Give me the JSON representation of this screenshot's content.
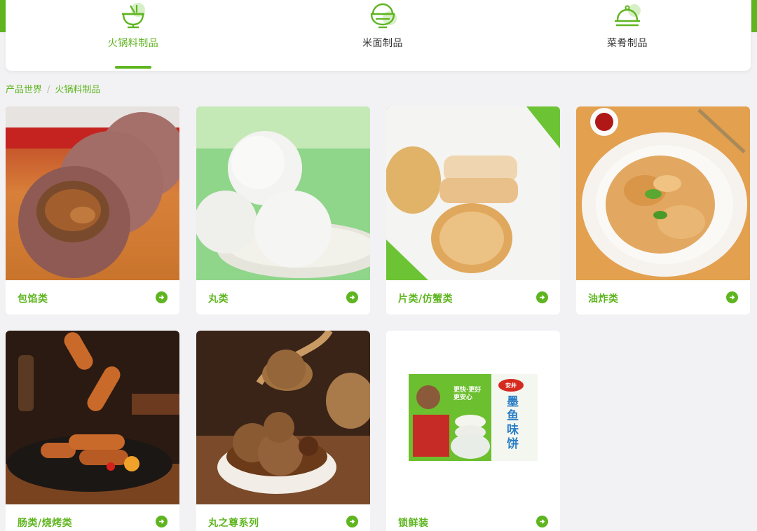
{
  "tabs": [
    {
      "label": "火锅料制品",
      "icon": "hotpot-bowl-icon",
      "active": true
    },
    {
      "label": "米面制品",
      "icon": "rice-bowl-icon",
      "active": false
    },
    {
      "label": "菜肴制品",
      "icon": "cloche-dish-icon",
      "active": false
    }
  ],
  "breadcrumb": [
    "产品世界",
    "火锅料制品"
  ],
  "products": [
    {
      "name": "包馅类",
      "image": "stuffed-meatball-photo"
    },
    {
      "name": "丸类",
      "image": "fish-balls-photo"
    },
    {
      "name": "片类/仿蟹类",
      "image": "fish-cakes-photo"
    },
    {
      "name": "油炸类",
      "image": "fried-snacks-photo"
    },
    {
      "name": "肠类/烧烤类",
      "image": "sausages-photo"
    },
    {
      "name": "丸之尊系列",
      "image": "braised-meatballs-photo"
    },
    {
      "name": "锁鲜装",
      "image": "fresh-pack-photo"
    }
  ],
  "package": {
    "slogan": "更快·更好 更安心",
    "brand": "安井",
    "product_name": "墨鱼味饼"
  },
  "colors": {
    "accent": "#5fb520",
    "page_bg": "#f2f2f4",
    "card_bg": "#ffffff",
    "text": "#333333"
  }
}
